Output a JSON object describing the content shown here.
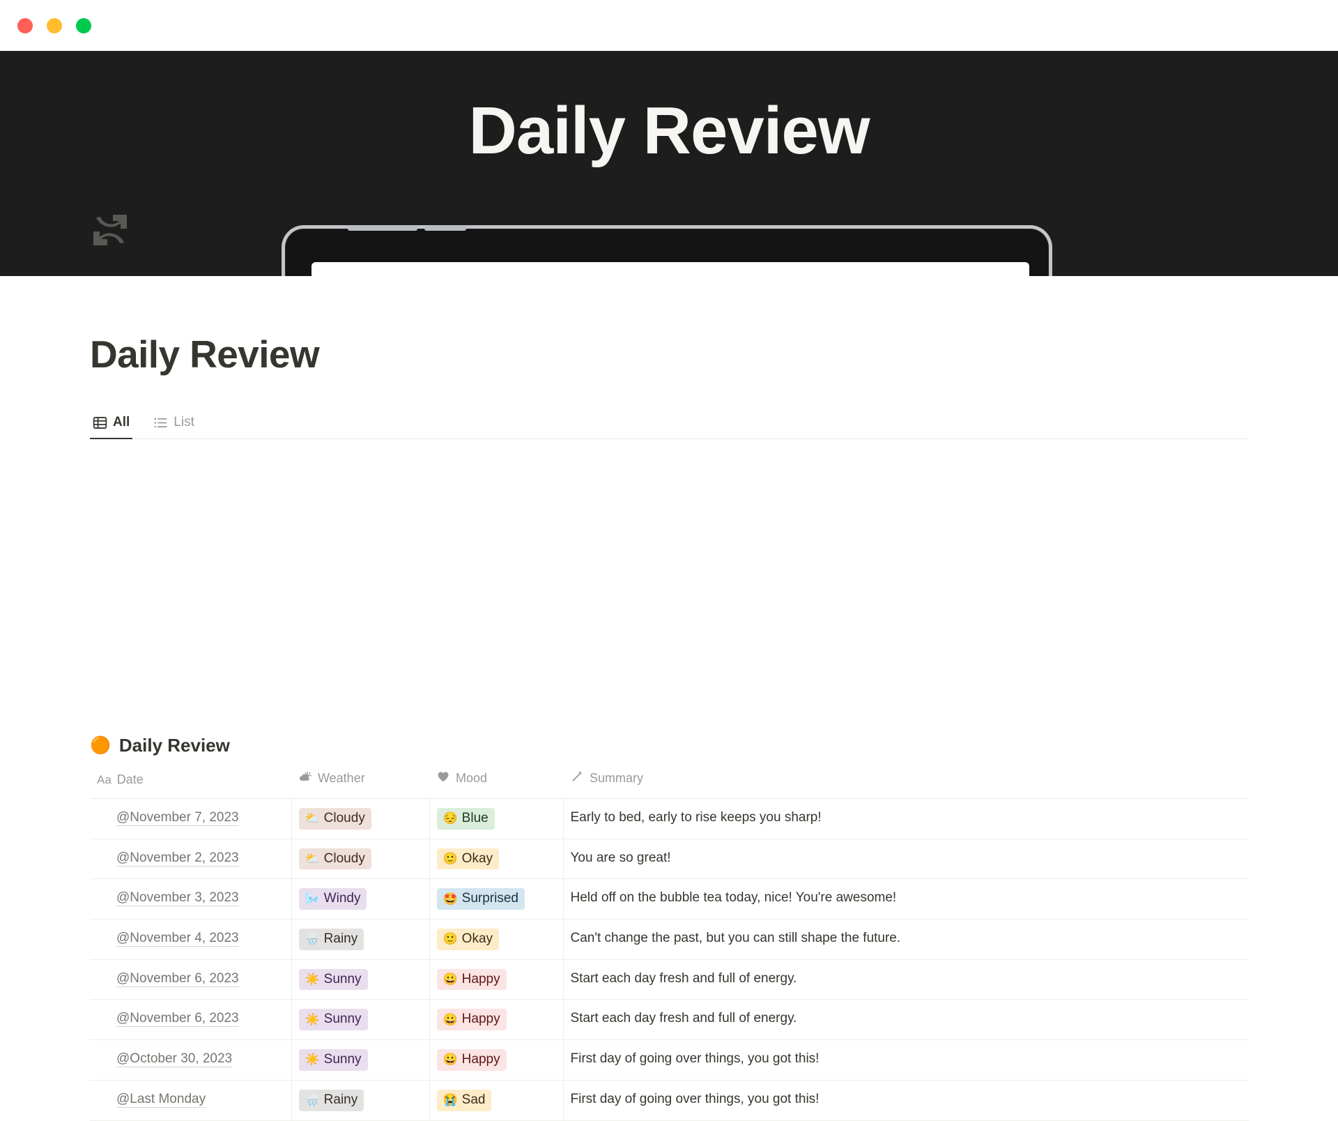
{
  "window": {
    "close_label": "close",
    "minimize_label": "minimize",
    "maximize_label": "maximize"
  },
  "hero": {
    "title": "Daily Review"
  },
  "page": {
    "title": "Daily Review",
    "icon": "refresh-icon"
  },
  "tabs": [
    {
      "label": "All",
      "icon": "table-icon",
      "active": true
    },
    {
      "label": "List",
      "icon": "list-icon",
      "active": false
    }
  ],
  "database": {
    "emoji": "🟠",
    "title": "Daily Review",
    "columns": [
      {
        "label": "Date",
        "icon": "aa-icon",
        "type": "title"
      },
      {
        "label": "Weather",
        "icon": "weather-icon",
        "type": "select"
      },
      {
        "label": "Mood",
        "icon": "heart-icon",
        "type": "select"
      },
      {
        "label": "Summary",
        "icon": "pencil-icon",
        "type": "text"
      }
    ],
    "rows": [
      {
        "date": "@November 7, 2023",
        "weather": {
          "emoji": "⛅",
          "label": "Cloudy",
          "color": "brown"
        },
        "mood": {
          "emoji": "😔",
          "label": "Blue",
          "color": "green"
        },
        "summary": "Early to bed, early to rise keeps you sharp!"
      },
      {
        "date": "@November 2, 2023",
        "weather": {
          "emoji": "⛅",
          "label": "Cloudy",
          "color": "brown"
        },
        "mood": {
          "emoji": "🙂",
          "label": "Okay",
          "color": "yellow"
        },
        "summary": "You are so great!"
      },
      {
        "date": "@November 3, 2023",
        "weather": {
          "emoji": "🌬️",
          "label": "Windy",
          "color": "purple"
        },
        "mood": {
          "emoji": "🤩",
          "label": "Surprised",
          "color": "blue"
        },
        "summary": "Held off on the bubble tea today, nice! You're awesome!"
      },
      {
        "date": "@November 4, 2023",
        "weather": {
          "emoji": "🌧️",
          "label": "Rainy",
          "color": "gray"
        },
        "mood": {
          "emoji": "🙂",
          "label": "Okay",
          "color": "yellow"
        },
        "summary": "Can't change the past, but you can still shape the future."
      },
      {
        "date": "@November 6, 2023",
        "weather": {
          "emoji": "☀️",
          "label": "Sunny",
          "color": "purple"
        },
        "mood": {
          "emoji": "😀",
          "label": "Happy",
          "color": "pink"
        },
        "summary": "Start each day fresh and full of energy."
      },
      {
        "date": "@November 6, 2023",
        "weather": {
          "emoji": "☀️",
          "label": "Sunny",
          "color": "purple"
        },
        "mood": {
          "emoji": "😀",
          "label": "Happy",
          "color": "pink"
        },
        "summary": "Start each day fresh and full of energy."
      },
      {
        "date": "@October 30, 2023",
        "weather": {
          "emoji": "☀️",
          "label": "Sunny",
          "color": "purple"
        },
        "mood": {
          "emoji": "😀",
          "label": "Happy",
          "color": "pink"
        },
        "summary": "First day of going over things, you got this!"
      },
      {
        "date": "@Last Monday",
        "weather": {
          "emoji": "🌧️",
          "label": "Rainy",
          "color": "gray"
        },
        "mood": {
          "emoji": "😭",
          "label": "Sad",
          "color": "yellow"
        },
        "summary": "First day of going over things, you got this!"
      }
    ]
  },
  "colors": {
    "hero_background": "#1d1d1d",
    "hero_text": "#f7f5f2",
    "text_primary": "#37352f",
    "text_muted": "#9b9a97",
    "border": "#e9e9e7"
  }
}
